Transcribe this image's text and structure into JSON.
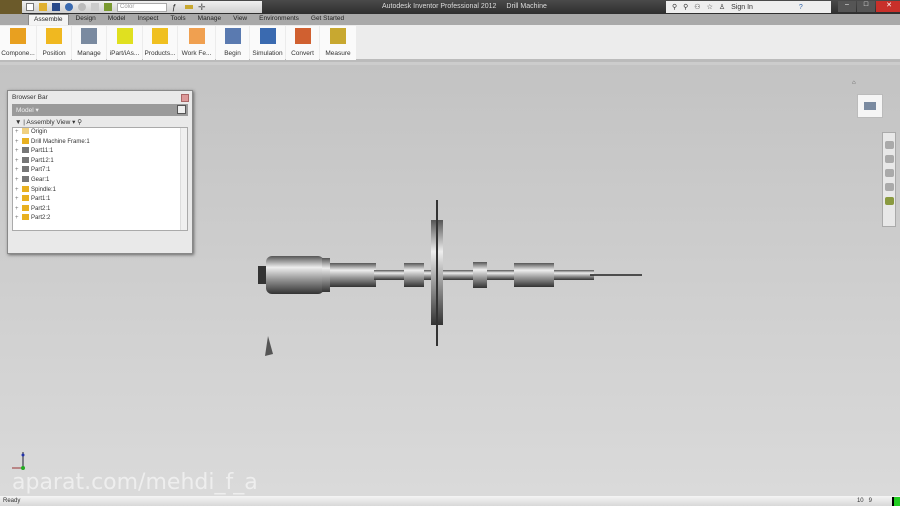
{
  "titlebar": {
    "app": "Autodesk Inventor Professional 2012",
    "document": "Drill Machine",
    "color_select": "Color",
    "sign_in": "Sign In"
  },
  "tabs": [
    "Assemble",
    "Design",
    "Model",
    "Inspect",
    "Tools",
    "Manage",
    "View",
    "Environments",
    "Get Started"
  ],
  "ribbon": [
    {
      "label": "Compone...",
      "icon": "place-component-icon",
      "color": "#e8a020"
    },
    {
      "label": "Position",
      "icon": "position-icon",
      "color": "#f0b820"
    },
    {
      "label": "Manage",
      "icon": "manage-icon",
      "color": "#7a8aa0"
    },
    {
      "label": "iPart/iAs...",
      "icon": "ipart-icon",
      "color": "#e0e020"
    },
    {
      "label": "Products...",
      "icon": "productivity-icon",
      "color": "#f0c020"
    },
    {
      "label": "Work Fe...",
      "icon": "work-features-icon",
      "color": "#f0a050"
    },
    {
      "label": "Begin",
      "icon": "begin-icon",
      "color": "#5a7ab0"
    },
    {
      "label": "Simulation",
      "icon": "simulation-icon",
      "color": "#3a6ab0"
    },
    {
      "label": "Convert",
      "icon": "convert-icon",
      "color": "#d06030"
    },
    {
      "label": "Measure",
      "icon": "measure-icon",
      "color": "#c8a830"
    }
  ],
  "browser": {
    "title": "Browser Bar",
    "model": "Model ▾",
    "view": "Assembly View",
    "items": [
      {
        "label": "Origin",
        "icon": "folder-icon"
      },
      {
        "label": "Drill Machine Frame:1",
        "icon": "assembly-icon"
      },
      {
        "label": "Part11:1",
        "icon": "part-icon"
      },
      {
        "label": "Part12:1",
        "icon": "part-icon"
      },
      {
        "label": "Part7:1",
        "icon": "part-icon"
      },
      {
        "label": "Gear:1",
        "icon": "part-icon"
      },
      {
        "label": "Spindle:1",
        "icon": "assembly-icon"
      },
      {
        "label": "Part1:1",
        "icon": "assembly-icon"
      },
      {
        "label": "Part2:1",
        "icon": "assembly-icon"
      },
      {
        "label": "Part2:2",
        "icon": "assembly-icon"
      }
    ]
  },
  "watermark": "aparat.com/mehdi_f_a",
  "status": {
    "text": "Ready",
    "count1": "10",
    "count2": "9"
  }
}
